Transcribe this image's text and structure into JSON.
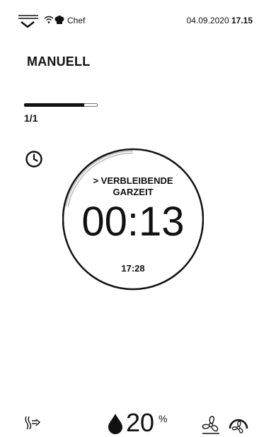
{
  "status_bar": {
    "profile_name": "Chef",
    "date": "04.09.2020",
    "time": "17.15"
  },
  "program": {
    "title": "MANUELL",
    "progress": 0.82,
    "step": "1/1"
  },
  "timer": {
    "label_line1": "> VERBLEIBENDE",
    "label_line2": "GARZEIT",
    "remaining": "00:13",
    "end_time": "17:28",
    "elapsed_fraction": 0.22
  },
  "bottom_bar": {
    "humidity_value": "20",
    "humidity_unit": "%"
  },
  "icons": {
    "menu": "menu-chevron-icon",
    "wifi": "wifi-icon",
    "chef": "chef-hat-icon",
    "clock": "clock-icon",
    "steam": "steam-icon",
    "drop": "water-drop-icon",
    "fan": "fan-icon",
    "fan_speed": "fan-speed-gauge-icon"
  }
}
